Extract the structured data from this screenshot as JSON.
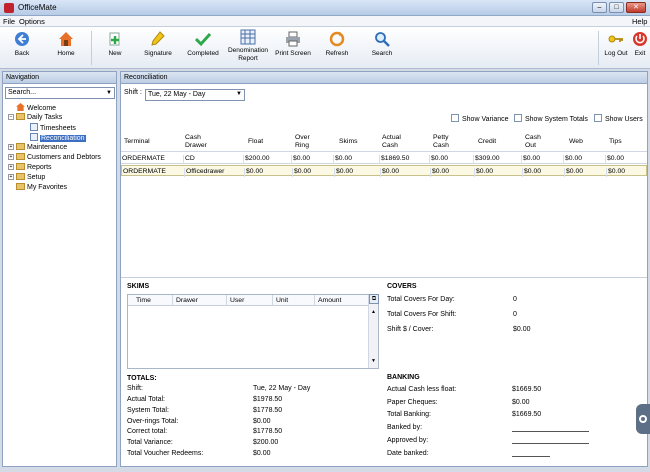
{
  "window": {
    "title": "OfficeMate",
    "minimize": "–",
    "maximize": "□",
    "close": "✕"
  },
  "menu": {
    "file": "File",
    "options": "Options",
    "help": "Help"
  },
  "toolbar": {
    "back": "Back",
    "home": "Home",
    "new": "New",
    "signature": "Signature",
    "completed": "Completed",
    "denomination_line1": "Denomination",
    "denomination_line2": "Report",
    "print_screen": "Print Screen",
    "refresh": "Refresh",
    "search": "Search",
    "log_out": "Log Out",
    "exit": "Exit"
  },
  "navigation": {
    "title": "Navigation",
    "search_value": "Search...",
    "items": [
      {
        "label": "Welcome"
      },
      {
        "label": "Daily Tasks"
      },
      {
        "label": "Timesheets"
      },
      {
        "label": "Reconciliation"
      },
      {
        "label": "Maintenance"
      },
      {
        "label": "Customers and Debtors"
      },
      {
        "label": "Reports"
      },
      {
        "label": "Setup"
      },
      {
        "label": "My Favorites"
      }
    ]
  },
  "reconciliation": {
    "title": "Reconciliation",
    "shift_label": "Shift :",
    "shift_value": "Tue, 22 May - Day",
    "options": {
      "show_variance": "Show Variance",
      "show_system_totals": "Show System Totals",
      "show_users": "Show Users"
    },
    "columns": [
      "Terminal",
      "Cash Drawer",
      "Float",
      "Over Ring",
      "Skims",
      "Actual Cash",
      "Petty Cash",
      "Credit",
      "Cash Out",
      "Web",
      "Tips"
    ],
    "rows": [
      [
        "ORDERMATE",
        "CD",
        "$200.00",
        "$0.00",
        "$0.00",
        "$1869.50",
        "$0.00",
        "$309.00",
        "$0.00",
        "$0.00",
        "$0.00"
      ],
      [
        "ORDERMATE",
        "Officedrawer",
        "$0.00",
        "$0.00",
        "$0.00",
        "$0.00",
        "$0.00",
        "$0.00",
        "$0.00",
        "$0.00",
        "$0.00"
      ]
    ]
  },
  "skims": {
    "title": "SKIMS",
    "columns": [
      "Time",
      "Drawer",
      "User",
      "Unit",
      "Amount"
    ],
    "button": "⧉"
  },
  "covers": {
    "title": "COVERS",
    "total_day_label": "Total Covers For Day:",
    "total_day": "0",
    "total_shift_label": "Total Covers For Shift:",
    "total_shift": "0",
    "per_cover_label": "Shift $ / Cover:",
    "per_cover": "$0.00"
  },
  "totals": {
    "title": "TOTALS:",
    "rows": [
      {
        "label": "Shift:",
        "value": "Tue, 22 May - Day"
      },
      {
        "label": "Actual Total:",
        "value": "$1978.50"
      },
      {
        "label": "System Total:",
        "value": "$1778.50"
      },
      {
        "label": "Over-rings Total:",
        "value": "$0.00"
      },
      {
        "label": "Correct total:",
        "value": "$1778.50"
      },
      {
        "label": "Total Variance:",
        "value": "$200.00"
      },
      {
        "label": "Total Voucher Redeems:",
        "value": "$0.00"
      }
    ]
  },
  "banking": {
    "title": "BANKING",
    "rows": [
      {
        "label": "Actual Cash less float:",
        "value": "$1669.50"
      },
      {
        "label": "Paper Cheques:",
        "value": "$0.00"
      },
      {
        "label": "Total Banking:",
        "value": "$1669.50"
      }
    ],
    "banked_by": "Banked by:",
    "approved_by": "Approved by:",
    "date_banked": "Date banked:"
  },
  "colors": {
    "accent": "#3c6fc4",
    "panel_header": "#bccde4",
    "highlight_row": "#fbf9e4"
  }
}
